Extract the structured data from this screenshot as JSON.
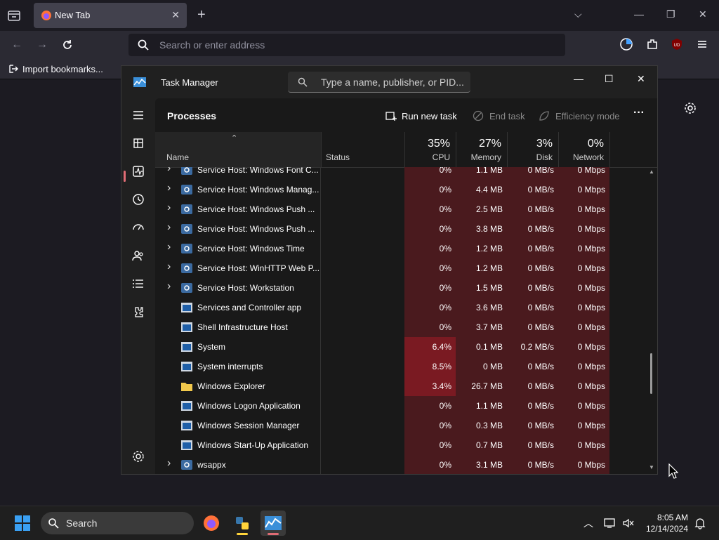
{
  "browser": {
    "tab_title": "New Tab",
    "url_placeholder": "Search or enter address",
    "bookmark_import": "Import bookmarks...",
    "icons": [
      "tab-list-icon",
      "firefox-icon",
      "close-icon",
      "plus-icon",
      "chevron-down-icon",
      "minimize-icon",
      "restore-icon",
      "close-window-icon",
      "back-icon",
      "forward-icon",
      "reload-icon",
      "search-icon",
      "account-icon",
      "extensions-icon",
      "ublock-icon",
      "menu-icon",
      "settings-icon"
    ]
  },
  "task_manager": {
    "title": "Task Manager",
    "search_placeholder": "Type a name, publisher, or PID...",
    "page_title": "Processes",
    "toolbar": {
      "run_new_task": "Run new task",
      "end_task": "End task",
      "efficiency_mode": "Efficiency mode"
    },
    "columns": {
      "name": "Name",
      "status": "Status",
      "cpu_pct": "35%",
      "cpu": "CPU",
      "memory_pct": "27%",
      "memory": "Memory",
      "disk_pct": "3%",
      "disk": "Disk",
      "network_pct": "0%",
      "network": "Network"
    },
    "rows": [
      {
        "name": "Service Host: Windows Font C...",
        "expandable": true,
        "icon": "gear",
        "cpu": "0%",
        "mem": "1.1 MB",
        "disk": "0 MB/s",
        "net": "0 Mbps",
        "cpu_level": 0
      },
      {
        "name": "Service Host: Windows Manag...",
        "expandable": true,
        "icon": "gear",
        "cpu": "0%",
        "mem": "4.4 MB",
        "disk": "0 MB/s",
        "net": "0 Mbps",
        "cpu_level": 0
      },
      {
        "name": "Service Host: Windows Push ...",
        "expandable": true,
        "icon": "gear",
        "cpu": "0%",
        "mem": "2.5 MB",
        "disk": "0 MB/s",
        "net": "0 Mbps",
        "cpu_level": 0
      },
      {
        "name": "Service Host: Windows Push ...",
        "expandable": true,
        "icon": "gear",
        "cpu": "0%",
        "mem": "3.8 MB",
        "disk": "0 MB/s",
        "net": "0 Mbps",
        "cpu_level": 0
      },
      {
        "name": "Service Host: Windows Time",
        "expandable": true,
        "icon": "gear",
        "cpu": "0%",
        "mem": "1.2 MB",
        "disk": "0 MB/s",
        "net": "0 Mbps",
        "cpu_level": 0
      },
      {
        "name": "Service Host: WinHTTP Web P...",
        "expandable": true,
        "icon": "gear",
        "cpu": "0%",
        "mem": "1.2 MB",
        "disk": "0 MB/s",
        "net": "0 Mbps",
        "cpu_level": 0
      },
      {
        "name": "Service Host: Workstation",
        "expandable": true,
        "icon": "gear",
        "cpu": "0%",
        "mem": "1.5 MB",
        "disk": "0 MB/s",
        "net": "0 Mbps",
        "cpu_level": 0
      },
      {
        "name": "Services and Controller app",
        "expandable": false,
        "icon": "window",
        "cpu": "0%",
        "mem": "3.6 MB",
        "disk": "0 MB/s",
        "net": "0 Mbps",
        "cpu_level": 0
      },
      {
        "name": "Shell Infrastructure Host",
        "expandable": false,
        "icon": "window",
        "cpu": "0%",
        "mem": "3.7 MB",
        "disk": "0 MB/s",
        "net": "0 Mbps",
        "cpu_level": 0
      },
      {
        "name": "System",
        "expandable": false,
        "icon": "window",
        "cpu": "6.4%",
        "mem": "0.1 MB",
        "disk": "0.2 MB/s",
        "net": "0 Mbps",
        "cpu_level": 2
      },
      {
        "name": "System interrupts",
        "expandable": false,
        "icon": "window",
        "cpu": "8.5%",
        "mem": "0 MB",
        "disk": "0 MB/s",
        "net": "0 Mbps",
        "cpu_level": 2
      },
      {
        "name": "Windows Explorer",
        "expandable": false,
        "icon": "folder",
        "cpu": "3.4%",
        "mem": "26.7 MB",
        "disk": "0 MB/s",
        "net": "0 Mbps",
        "cpu_level": 2
      },
      {
        "name": "Windows Logon Application",
        "expandable": false,
        "icon": "window",
        "cpu": "0%",
        "mem": "1.1 MB",
        "disk": "0 MB/s",
        "net": "0 Mbps",
        "cpu_level": 0
      },
      {
        "name": "Windows Session Manager",
        "expandable": false,
        "icon": "window",
        "cpu": "0%",
        "mem": "0.3 MB",
        "disk": "0 MB/s",
        "net": "0 Mbps",
        "cpu_level": 0
      },
      {
        "name": "Windows Start-Up Application",
        "expandable": false,
        "icon": "window",
        "cpu": "0%",
        "mem": "0.7 MB",
        "disk": "0 MB/s",
        "net": "0 Mbps",
        "cpu_level": 0
      },
      {
        "name": "wsappx",
        "expandable": true,
        "icon": "gear",
        "cpu": "0%",
        "mem": "3.1 MB",
        "disk": "0 MB/s",
        "net": "0 Mbps",
        "cpu_level": 0
      }
    ],
    "sidebar_icons": [
      "hamburger-icon",
      "processes-icon",
      "performance-icon",
      "app-history-icon",
      "startup-apps-icon",
      "users-icon",
      "details-icon",
      "services-icon",
      "settings-icon"
    ]
  },
  "taskbar": {
    "search_label": "Search",
    "time": "8:05 AM",
    "date": "12/14/2024"
  },
  "colors": {
    "cpu_high": "#7a1a22",
    "cpu_low": "#4a1a1e",
    "other_cols": "#4a1a1e",
    "accent": "#e06c75"
  }
}
